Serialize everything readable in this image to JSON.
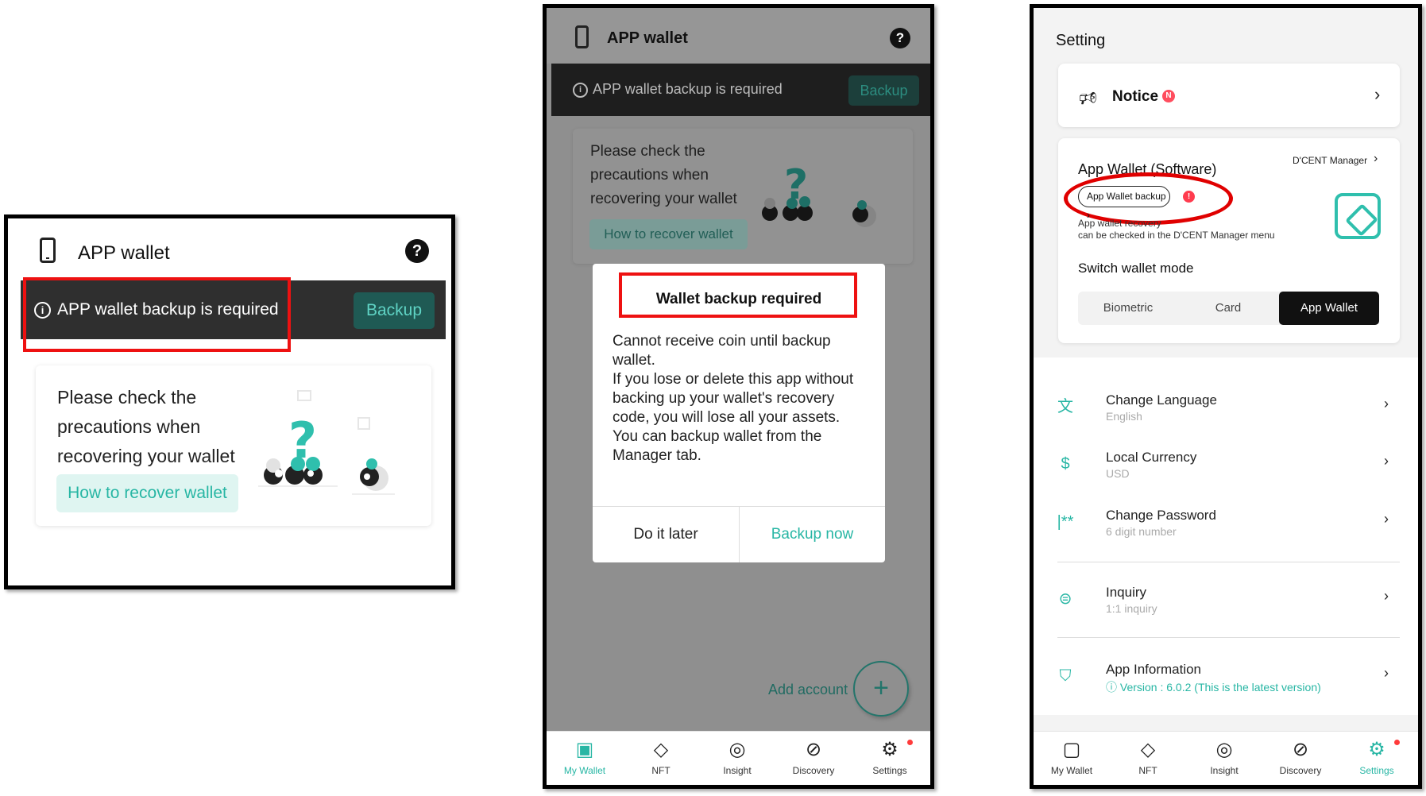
{
  "panel1": {
    "title": "APP wallet",
    "help": "?",
    "banner": {
      "info": "i",
      "message": "APP wallet backup is required",
      "button": "Backup"
    },
    "card": {
      "text": "Please check the precautions when recovering your wallet",
      "button": "How to recover wallet"
    }
  },
  "panel2": {
    "title": "APP wallet",
    "help": "?",
    "banner": {
      "info": "i",
      "message": "APP wallet backup is required",
      "button": "Backup"
    },
    "card": {
      "text": "Please check the precautions when recovering your wallet",
      "button": "How to recover wallet"
    },
    "dialog": {
      "title": "Wallet backup required",
      "body": "Cannot receive coin until backup wallet.\nIf you lose or delete this app without backing up your wallet's recovery code, you will lose all your assets.\nYou can backup wallet from the Manager tab.",
      "later": "Do it later",
      "now": "Backup now"
    },
    "add_account": "Add account",
    "fab": "+",
    "tabs": [
      {
        "label": "My Wallet",
        "icon": "wallet-icon",
        "glyph": "▣"
      },
      {
        "label": "NFT",
        "icon": "diamond-icon",
        "glyph": "◇"
      },
      {
        "label": "Insight",
        "icon": "lightbulb-icon",
        "glyph": "◎"
      },
      {
        "label": "Discovery",
        "icon": "compass-icon",
        "glyph": "⊘"
      },
      {
        "label": "Settings",
        "icon": "gear-icon",
        "glyph": "⚙"
      }
    ]
  },
  "panel3": {
    "title": "Setting",
    "notice": {
      "label": "Notice",
      "badge": "N"
    },
    "wallet": {
      "title": "App Wallet (Software)",
      "manager_link": "D'CENT Manager",
      "backup_button": "App Wallet backup",
      "alert": "!",
      "recovery_line1": "App wallet recovery",
      "recovery_line2": "can be checked in the D'CENT Manager menu",
      "switch_title": "Switch wallet mode",
      "modes": [
        "Biometric",
        "Card",
        "App Wallet"
      ],
      "active_mode": "App Wallet"
    },
    "rows": [
      {
        "title": "Change Language",
        "sub": "English",
        "icon": "translate-icon",
        "glyph": "文"
      },
      {
        "title": "Local Currency",
        "sub": "USD",
        "icon": "dollar-icon",
        "glyph": "$"
      },
      {
        "title": "Change Password",
        "sub": "6 digit number",
        "icon": "password-icon",
        "glyph": "|**"
      },
      {
        "title": "Inquiry",
        "sub": "1:1 inquiry",
        "icon": "chat-icon",
        "glyph": "⊜"
      },
      {
        "title": "App Information",
        "sub": "ⓘ Version : 6.0.2 (This is the latest version)",
        "icon": "shield-icon",
        "glyph": "⛉"
      }
    ],
    "tabs": [
      {
        "label": "My Wallet",
        "icon": "wallet-icon",
        "glyph": "▢"
      },
      {
        "label": "NFT",
        "icon": "diamond-icon",
        "glyph": "◇"
      },
      {
        "label": "Insight",
        "icon": "lightbulb-icon",
        "glyph": "◎"
      },
      {
        "label": "Discovery",
        "icon": "compass-icon",
        "glyph": "⊘"
      },
      {
        "label": "Settings",
        "icon": "gear-icon",
        "glyph": "⚙"
      }
    ]
  },
  "colors": {
    "accent": "#27b6a4",
    "highlight": "#ee1111",
    "dark_banner": "#2f2f2f"
  }
}
